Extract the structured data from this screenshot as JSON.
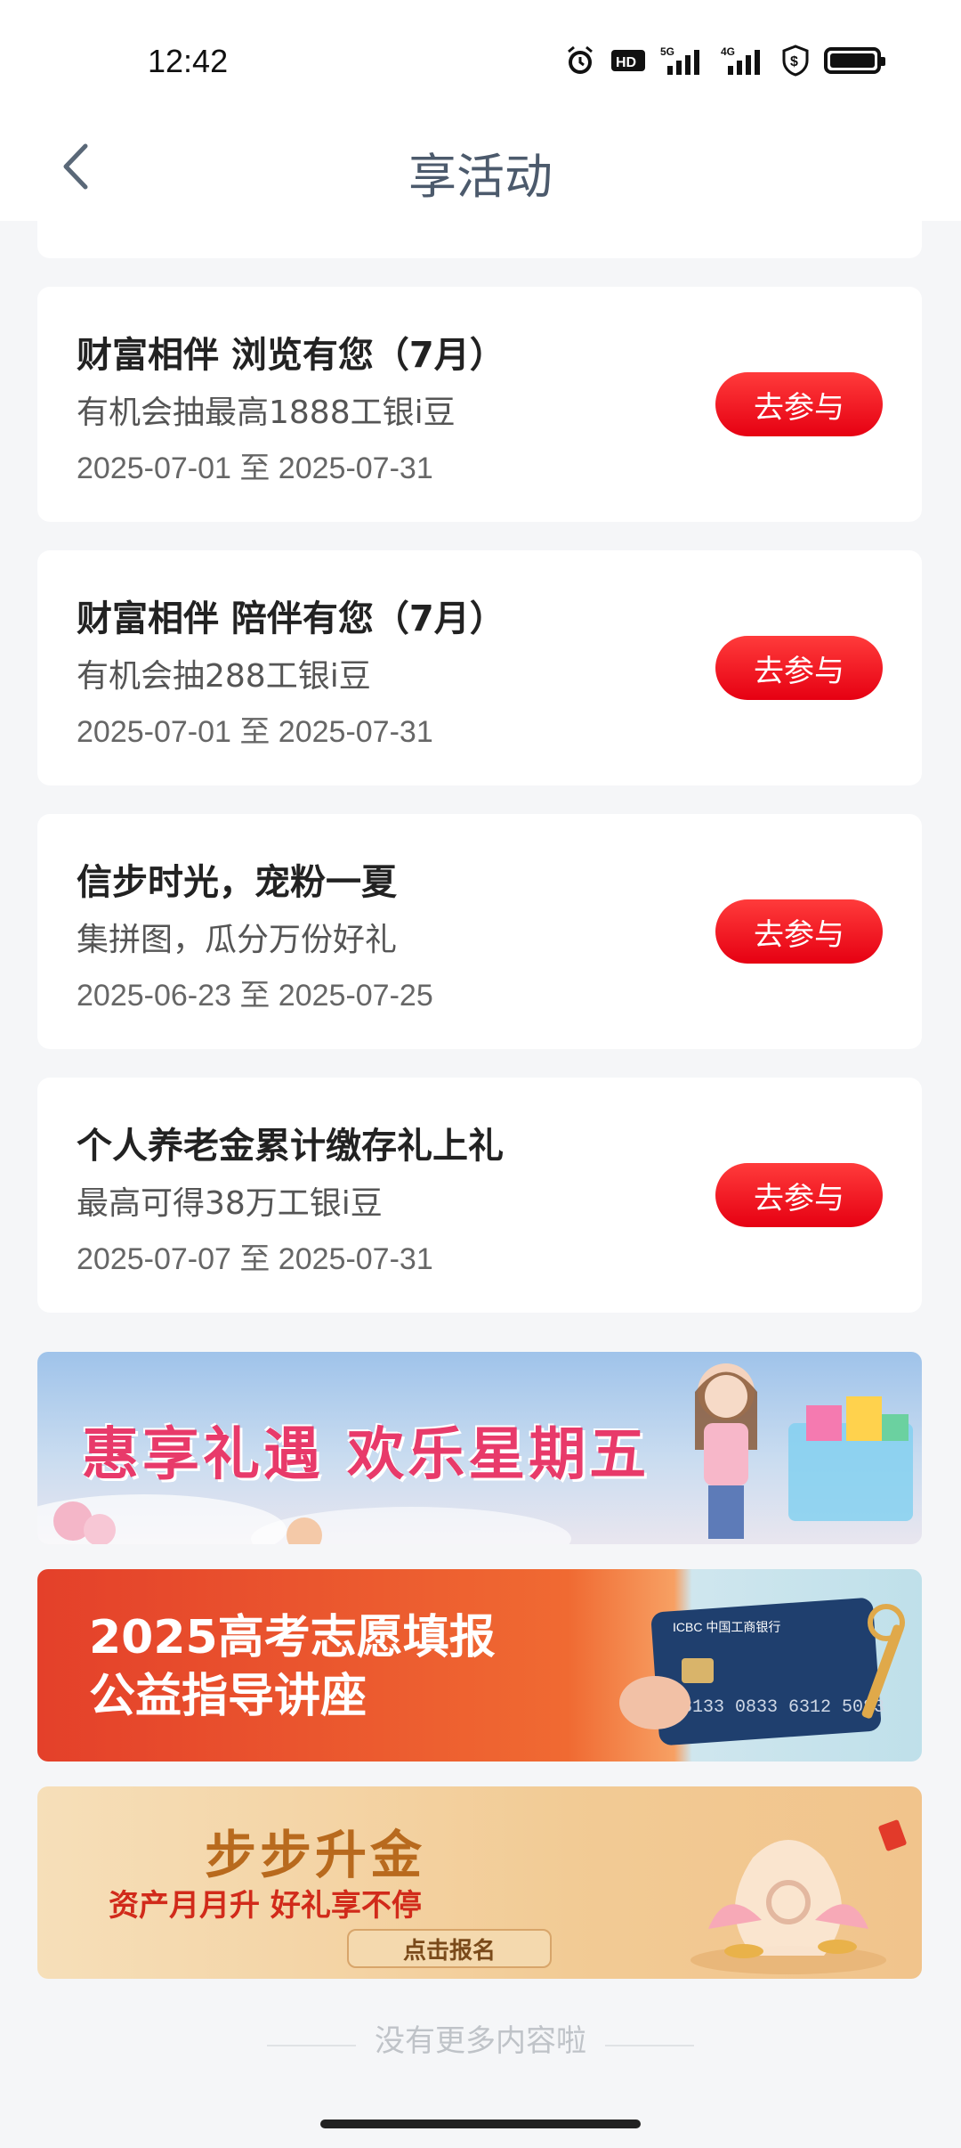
{
  "status_bar": {
    "time": "12:42",
    "icons": [
      "alarm-icon",
      "hd-icon",
      "5g-signal-icon",
      "4g-signal-icon",
      "shield-dollar-icon",
      "battery-icon"
    ]
  },
  "nav": {
    "title": "享活动",
    "back_icon": "chevron-left-icon"
  },
  "activities": [
    {
      "title": "财富相伴 浏览有您（7月）",
      "desc": "有机会抽最高1888工银i豆",
      "date": "2025-07-01 至 2025-07-31",
      "button": "去参与"
    },
    {
      "title": "财富相伴 陪伴有您（7月）",
      "desc": "有机会抽288工银i豆",
      "date": "2025-07-01 至 2025-07-31",
      "button": "去参与"
    },
    {
      "title": "信步时光，宠粉一夏",
      "desc": "集拼图，瓜分万份好礼",
      "date": "2025-06-23 至 2025-07-25",
      "button": "去参与"
    },
    {
      "title": "个人养老金累计缴存礼上礼",
      "desc": "最高可得38万工银i豆",
      "date": "2025-07-07 至 2025-07-31",
      "button": "去参与"
    }
  ],
  "banners": [
    {
      "text": "惠享礼遇 欢乐星期五"
    },
    {
      "text": "2025高考志愿填报\n公益指导讲座",
      "line1": "2025高考志愿填报",
      "line2": "公益指导讲座",
      "card_brand": "ICBC 中国工商银行"
    },
    {
      "title": "步步升金",
      "subtitle": "资产月月升  好礼享不停",
      "button": "点击报名"
    }
  ],
  "footer": {
    "text": "没有更多内容啦"
  },
  "colors": {
    "accent_red": "#e60012",
    "title_gray": "#4c5a6c"
  }
}
